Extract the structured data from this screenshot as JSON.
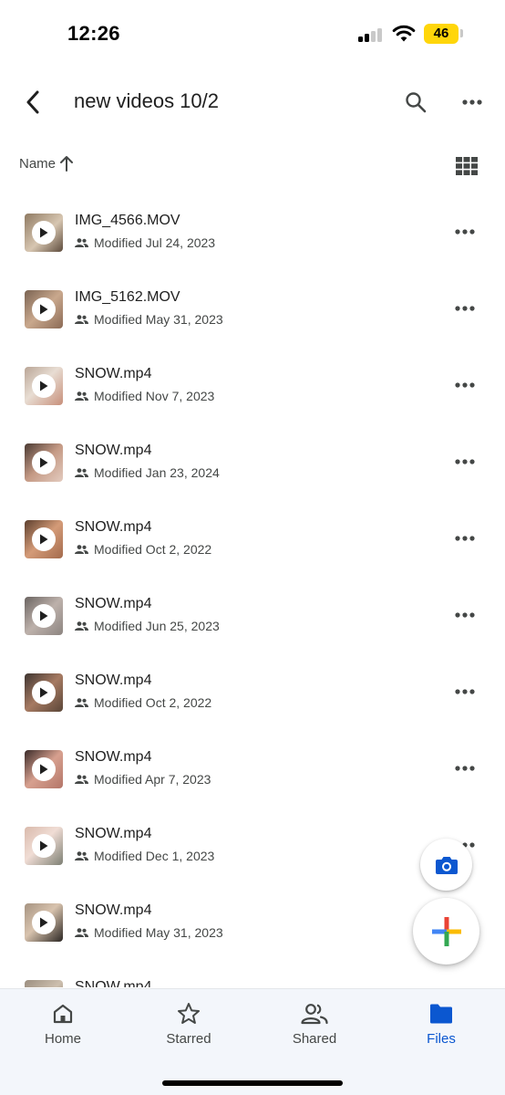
{
  "status_bar": {
    "time": "12:26",
    "battery": "46"
  },
  "header": {
    "title": "new videos 10/2"
  },
  "sort": {
    "label": "Name"
  },
  "files": [
    {
      "name": "IMG_4566.MOV",
      "modified": "Modified Jul 24, 2023"
    },
    {
      "name": "IMG_5162.MOV",
      "modified": "Modified May 31, 2023"
    },
    {
      "name": "SNOW.mp4",
      "modified": "Modified Nov 7, 2023"
    },
    {
      "name": "SNOW.mp4",
      "modified": "Modified Jan 23, 2024"
    },
    {
      "name": "SNOW.mp4",
      "modified": "Modified Oct 2, 2022"
    },
    {
      "name": "SNOW.mp4",
      "modified": "Modified Jun 25, 2023"
    },
    {
      "name": "SNOW.mp4",
      "modified": "Modified Oct 2, 2022"
    },
    {
      "name": "SNOW.mp4",
      "modified": "Modified Apr 7, 2023"
    },
    {
      "name": "SNOW.mp4",
      "modified": "Modified Dec 1, 2023"
    },
    {
      "name": "SNOW.mp4",
      "modified": "Modified May 31, 2023"
    },
    {
      "name": "SNOW.mp4",
      "modified": ""
    }
  ],
  "nav": {
    "home": "Home",
    "starred": "Starred",
    "shared": "Shared",
    "files": "Files"
  },
  "colors": {
    "accent": "#0b57d0",
    "text_primary": "#1f1f1f",
    "text_secondary": "#444746",
    "nav_background": "#f3f6fb",
    "battery": "#ffd60a"
  },
  "icons": {
    "back": "back-arrow-icon",
    "search": "search-icon",
    "more": "more-horizontal-icon",
    "sort": "arrow-up-icon",
    "view": "grid-view-icon",
    "shared": "people-icon",
    "play": "play-icon",
    "camera": "camera-icon",
    "add": "plus-icon",
    "home": "home-icon",
    "starred": "star-icon",
    "files": "folder-icon"
  }
}
